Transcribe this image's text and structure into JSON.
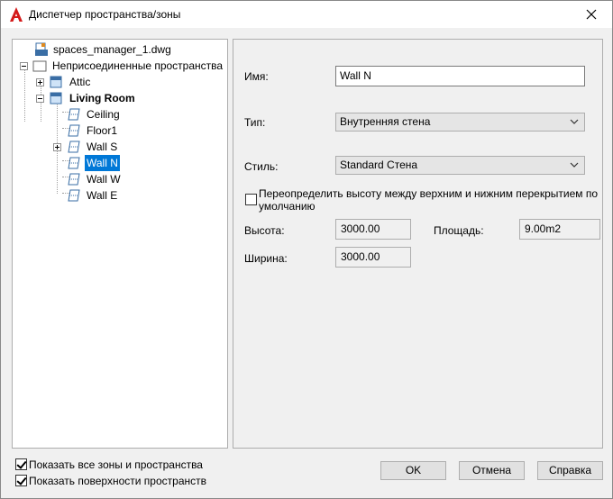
{
  "window": {
    "title": "Диспетчер пространства/зоны"
  },
  "tree": {
    "root": "spaces_manager_1.dwg",
    "group": "Неприсоединенные пространства",
    "attic": "Attic",
    "living_room": "Living Room",
    "children": [
      "Ceiling",
      "Floor1",
      "Wall S",
      "Wall N",
      "Wall W",
      "Wall E"
    ],
    "selected": "Wall N"
  },
  "props": {
    "name_label": "Имя:",
    "name_value": "Wall N",
    "type_label": "Тип:",
    "type_value": "Внутренняя стена",
    "style_label": "Стиль:",
    "style_value": "Standard Стена",
    "override_label_line1": "Переопределить высоту между верхним и нижним перекрытием по",
    "override_label_line2": "умолчанию",
    "override_checked": false,
    "height_label": "Высота:",
    "height_value": "3000.00",
    "area_label": "Площадь:",
    "area_value": "9.00m2",
    "width_label": "Ширина:",
    "width_value": "3000.00"
  },
  "footer": {
    "show_all_label": "Показать все зоны и пространства",
    "show_all_checked": true,
    "show_surfaces_label": "Показать поверхности пространств",
    "show_surfaces_checked": true,
    "ok_label": "OK",
    "cancel_label": "Отмена",
    "help_label": "Справка"
  },
  "colors": {
    "selection": "#0078d7",
    "app_icon_red": "#d41a1a"
  }
}
